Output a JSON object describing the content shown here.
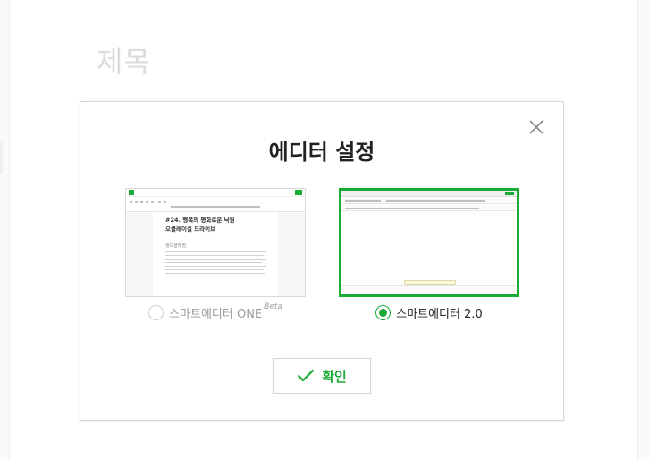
{
  "background": {
    "title_placeholder": "제목"
  },
  "modal": {
    "title": "에디터 설정",
    "close_icon": "close-icon",
    "options": [
      {
        "label": "스마트에디터 ONE",
        "badge": "Beta",
        "selected": false,
        "thumbnail": {
          "doc_title_line1": "#24. 행복의 평화로운 낙원",
          "doc_title_line2": "오클레이실 드라이브",
          "doc_subtitle": "월드클래썸"
        }
      },
      {
        "label": "스마트에디터 2.0",
        "selected": true
      }
    ],
    "confirm": {
      "label": "확인",
      "icon": "check-icon"
    }
  },
  "colors": {
    "accent": "#19ab36",
    "title": "#222222",
    "muted": "#9a9a9a",
    "border": "#d6d6d6"
  }
}
